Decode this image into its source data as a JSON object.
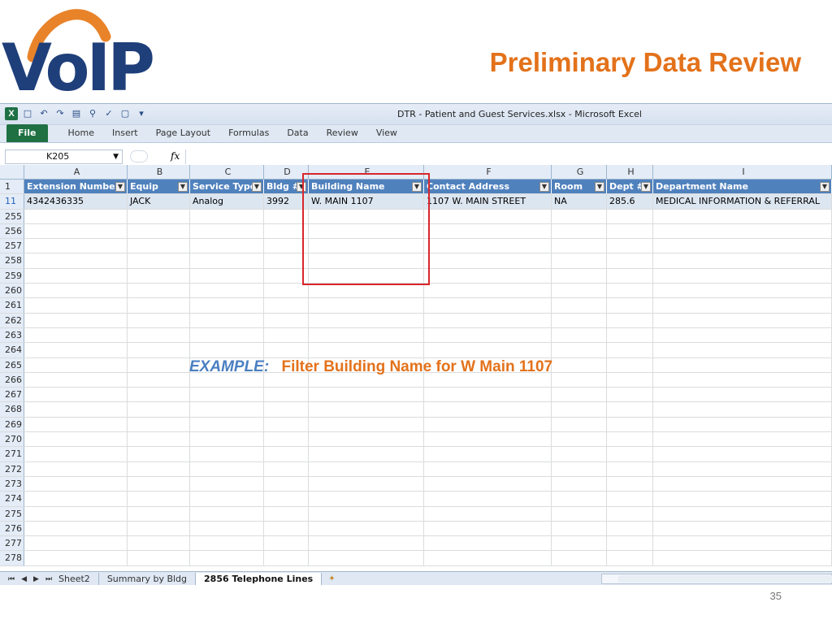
{
  "slide": {
    "logo_text": "VoIP",
    "title": "Preliminary Data Review",
    "page_number": "35"
  },
  "window": {
    "title": "DTR - Patient and Guest Services.xlsx  -  Microsoft Excel"
  },
  "ribbon": {
    "tabs": [
      "File",
      "Home",
      "Insert",
      "Page Layout",
      "Formulas",
      "Data",
      "Review",
      "View"
    ]
  },
  "formula_bar": {
    "name_box": "K205",
    "fx": "fx",
    "value": ""
  },
  "columns": [
    "A",
    "B",
    "C",
    "D",
    "E",
    "F",
    "G",
    "H",
    "I"
  ],
  "headers": [
    "Extension Number",
    "Equip",
    "Service Type",
    "Bldg #",
    "Building Name",
    "Contact Address",
    "Room",
    "Dept #",
    "Department Name"
  ],
  "header_row_number": "1",
  "data_row": {
    "row_number": "11",
    "cells": [
      "4342436335",
      "JACK",
      "Analog",
      "3992",
      "W. MAIN 1107",
      "1107 W. MAIN STREET",
      "NA",
      "285.6",
      "MEDICAL INFORMATION & REFERRAL"
    ]
  },
  "empty_rows": [
    "255",
    "256",
    "257",
    "258",
    "259",
    "260",
    "261",
    "262",
    "263",
    "264",
    "265",
    "266",
    "267",
    "268",
    "269",
    "270",
    "271",
    "272",
    "273",
    "274",
    "275",
    "276",
    "277",
    "278"
  ],
  "annotation": {
    "label": "EXAMPLE:",
    "text": "Filter Building Name for W Main 1107"
  },
  "sheets": {
    "tabs": [
      "Sheet2",
      "Summary by Bldg",
      "2856 Telephone Lines"
    ],
    "active": "2856 Telephone Lines"
  },
  "colors": {
    "accent_orange": "#e3721b",
    "header_blue": "#4f81bd",
    "highlight_red": "#d9262c",
    "logo_navy": "#1f3f7a"
  }
}
